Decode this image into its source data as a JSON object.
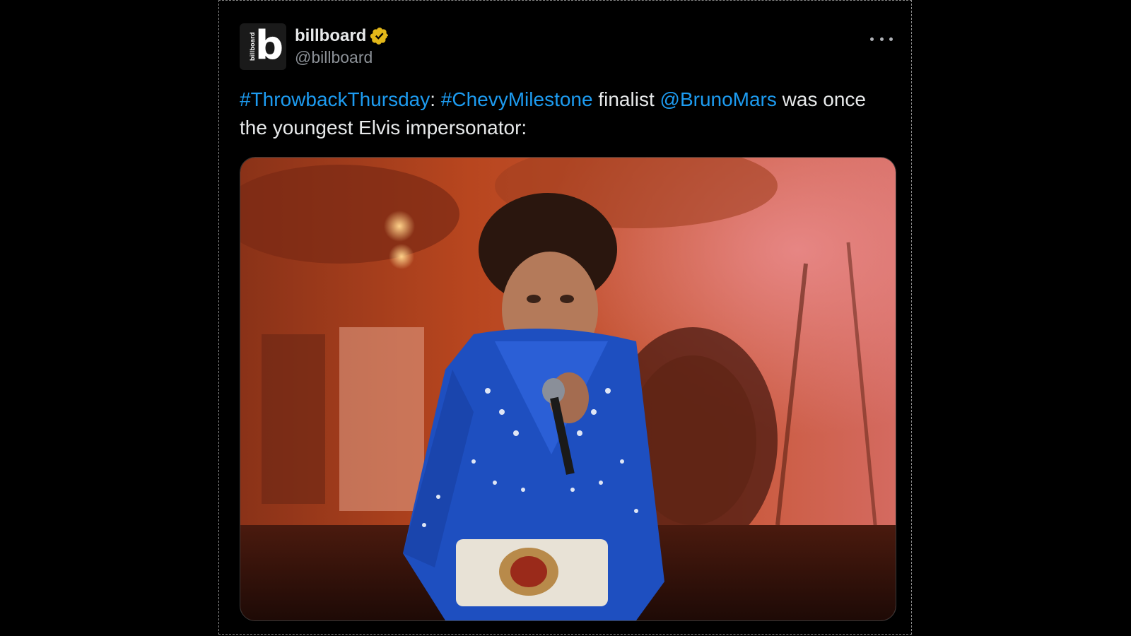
{
  "account": {
    "avatar_letter": "b",
    "avatar_side_text": "billboard",
    "display_name": "billboard",
    "handle": "@billboard",
    "verified_color": "#e2b719"
  },
  "tweet": {
    "hashtag_1": "#ThrowbackThursday",
    "sep_1": ": ",
    "hashtag_2": "#ChevyMilestone",
    "text_1": " finalist ",
    "mention": "@BrunoMars",
    "text_2": " was once the youngest Elvis impersonator:"
  },
  "media": {
    "kind": "gif-photo"
  },
  "icons": {
    "more": "more-horizontal-icon",
    "verified": "verified-badge-icon"
  },
  "colors": {
    "background": "#000000",
    "link": "#1d9bf0",
    "text": "#e7e9ea",
    "secondary": "#8b9096"
  }
}
